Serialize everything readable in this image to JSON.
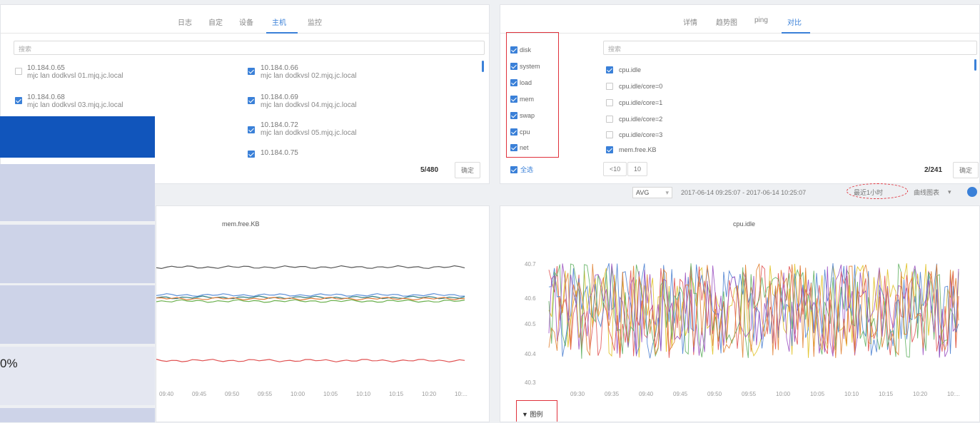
{
  "left_panel": {
    "tabs": [
      "日志",
      "自定",
      "设备",
      "主机",
      "监控"
    ],
    "active_tab_index": 3,
    "search_placeholder": "搜索",
    "hosts": [
      {
        "ip": "10.184.0.65",
        "name": "mjc lan dodkvsl 01.mjq.jc.local",
        "checked": false
      },
      {
        "ip": "10.184.0.66",
        "name": "mjc lan dodkvsl 02.mjq.jc.local",
        "checked": true
      },
      {
        "ip": "10.184.0.68",
        "name": "mjc lan dodkvsl 03.mjq.jc.local",
        "checked": true
      },
      {
        "ip": "10.184.0.69",
        "name": "mjc lan dodkvsl 04.mjq.jc.local",
        "checked": true
      },
      {
        "ip": "10.184.0.72",
        "name": "mjc lan dodkvsl 05.mjq.jc.local",
        "checked": true
      },
      {
        "ip": "10.184.0.75",
        "name": "",
        "checked": true
      }
    ],
    "count": "5/480",
    "confirm_label": "确定"
  },
  "right_panel": {
    "tabs": [
      "详情",
      "趋势图",
      "ping",
      "对比"
    ],
    "active_tab_index": 3,
    "categories": [
      {
        "label": "disk",
        "checked": true
      },
      {
        "label": "system",
        "checked": true
      },
      {
        "label": "load",
        "checked": true
      },
      {
        "label": "mem",
        "checked": true
      },
      {
        "label": "swap",
        "checked": true
      },
      {
        "label": "cpu",
        "checked": true
      },
      {
        "label": "net",
        "checked": true
      }
    ],
    "select_all_label": "全选",
    "search_placeholder": "搜索",
    "metrics": [
      {
        "label": "cpu.idle",
        "checked": true
      },
      {
        "label": "cpu.idle/core=0",
        "checked": false
      },
      {
        "label": "cpu.idle/core=1",
        "checked": false
      },
      {
        "label": "cpu.idle/core=2",
        "checked": false
      },
      {
        "label": "cpu.idle/core=3",
        "checked": false
      },
      {
        "label": "mem.free.KB",
        "checked": true
      }
    ],
    "page_a": "<10",
    "page_b": "10",
    "count": "2/241",
    "confirm_label": "确定"
  },
  "filter_bar": {
    "aggregate": "AVG",
    "time_range": "2017-06-14 09:25:07 - 2017-06-14 10:25:07",
    "scope": "最近1小时",
    "mode": "曲线图表"
  },
  "charts": {
    "left_title": "mem.free.KB",
    "right_title": "cpu.idle",
    "legend_toggle": "▼ 图例"
  },
  "sidebar": {
    "percent_text": "0%",
    "accent": "#1155bb",
    "row_color": "#cdd3e8"
  },
  "chart_data": [
    {
      "type": "line",
      "title": "mem.free.KB",
      "x": [
        "09:40",
        "09:45",
        "09:50",
        "09:55",
        "10:00",
        "10:05",
        "10:10",
        "10:15",
        "10:20",
        "10:..."
      ],
      "series": [
        {
          "color": "#555555",
          "level": 0.85
        },
        {
          "color": "#5b8fd8",
          "level": 0.62
        },
        {
          "color": "#2e7d7d",
          "level": 0.6
        },
        {
          "color": "#6ab04c",
          "level": 0.57
        },
        {
          "color": "#e07b39",
          "level": 0.59
        },
        {
          "color": "#e05050",
          "level": 0.08
        }
      ]
    },
    {
      "type": "line",
      "title": "cpu.idle",
      "yticks": [
        "40.7",
        "40.6",
        "40.5",
        "40.4",
        "40.3"
      ],
      "x": [
        "09:30",
        "09:35",
        "09:40",
        "09:45",
        "09:50",
        "09:55",
        "10:00",
        "10:05",
        "10:10",
        "10:15",
        "10:20",
        "10:..."
      ],
      "series": [
        {
          "color": "#e0c020"
        },
        {
          "color": "#e05050"
        },
        {
          "color": "#4a7fd0"
        },
        {
          "color": "#5fb05f"
        },
        {
          "color": "#9a4fc0"
        },
        {
          "color": "#e08030"
        }
      ]
    }
  ]
}
